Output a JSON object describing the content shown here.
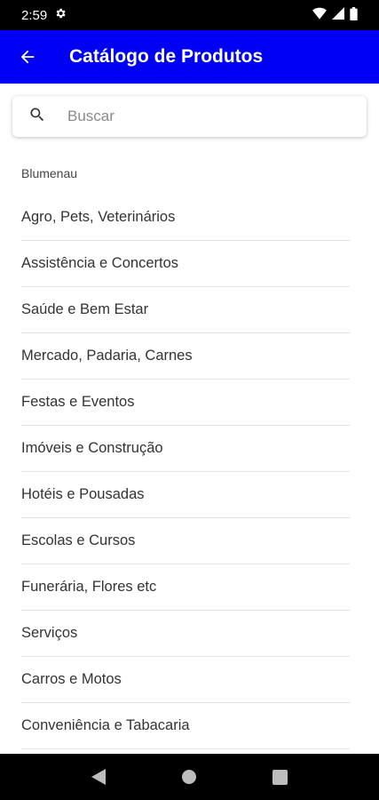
{
  "status_bar": {
    "time": "2:59",
    "icons": [
      "settings-gear-icon",
      "wifi-icon",
      "signal-icon",
      "battery-icon"
    ]
  },
  "app_bar": {
    "title": "Catálogo de Produtos",
    "background": "#0000f5",
    "back_icon": "arrow-left-icon"
  },
  "search": {
    "placeholder": "Buscar",
    "icon": "search-icon"
  },
  "section": {
    "header": "Blumenau"
  },
  "categories": [
    {
      "label": "Agro, Pets, Veterinários"
    },
    {
      "label": "Assistência e Concertos"
    },
    {
      "label": "Saúde e Bem Estar"
    },
    {
      "label": "Mercado, Padaria, Carnes"
    },
    {
      "label": "Festas e Eventos"
    },
    {
      "label": "Imóveis e Construção"
    },
    {
      "label": "Hotéis e Pousadas"
    },
    {
      "label": "Escolas e Cursos"
    },
    {
      "label": "Funerária, Flores etc"
    },
    {
      "label": "Serviços"
    },
    {
      "label": "Carros e Motos"
    },
    {
      "label": "Conveniência e Tabacaria"
    }
  ],
  "nav_bar": {
    "icons": [
      "back-triangle-icon",
      "home-circle-icon",
      "recents-square-icon"
    ]
  }
}
